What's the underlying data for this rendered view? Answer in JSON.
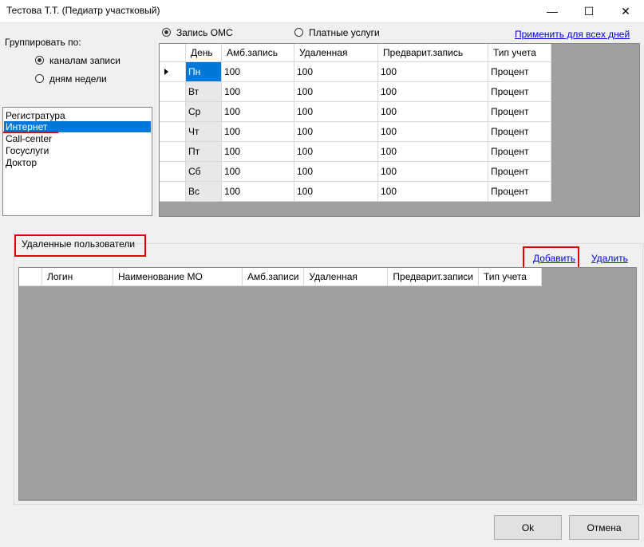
{
  "window": {
    "title": "Тестова Т.Т. (Педиатр участковый)",
    "minimize_glyph": "—",
    "maximize_glyph": "☐",
    "close_glyph": "✕"
  },
  "grouping": {
    "label": "Группировать по:",
    "options": [
      {
        "label": "каналам записи",
        "checked": true
      },
      {
        "label": "дням недели",
        "checked": false
      }
    ]
  },
  "channels": {
    "items": [
      "Регистратура",
      "Интернет",
      "Call-center",
      "Госуслуги",
      "Доктор"
    ],
    "selected_index": 1
  },
  "payment_type": {
    "options": [
      {
        "label": "Запись ОМС",
        "checked": true
      },
      {
        "label": "Платные услуги",
        "checked": false
      }
    ]
  },
  "apply_all_link": "Применить для всех дней",
  "quota_grid": {
    "columns": [
      "День",
      "Амб.запись",
      "Удаленная",
      "Предварит.запись",
      "Тип учета"
    ],
    "rows": [
      [
        "Пн",
        "100",
        "100",
        "100",
        "Процент"
      ],
      [
        "Вт",
        "100",
        "100",
        "100",
        "Процент"
      ],
      [
        "Ср",
        "100",
        "100",
        "100",
        "Процент"
      ],
      [
        "Чт",
        "100",
        "100",
        "100",
        "Процент"
      ],
      [
        "Пт",
        "100",
        "100",
        "100",
        "Процент"
      ],
      [
        "Сб",
        "100",
        "100",
        "100",
        "Процент"
      ],
      [
        "Вс",
        "100",
        "100",
        "100",
        "Процент"
      ]
    ],
    "current_row": 0
  },
  "remote_users": {
    "group_title": "Удаленные пользователи",
    "add_link": "Добавить",
    "delete_link": "Удалить",
    "columns": [
      "Логин",
      "Наименование МО",
      "Амб.записи",
      "Удаленная",
      "Предварит.записи",
      "Тип учета"
    ]
  },
  "buttons": {
    "ok": "Ok",
    "cancel": "Отмена"
  },
  "colors": {
    "selection": "#0078d7",
    "highlight_box": "#e00000",
    "underline": "#e00000",
    "grid_background": "#a0a0a0"
  }
}
